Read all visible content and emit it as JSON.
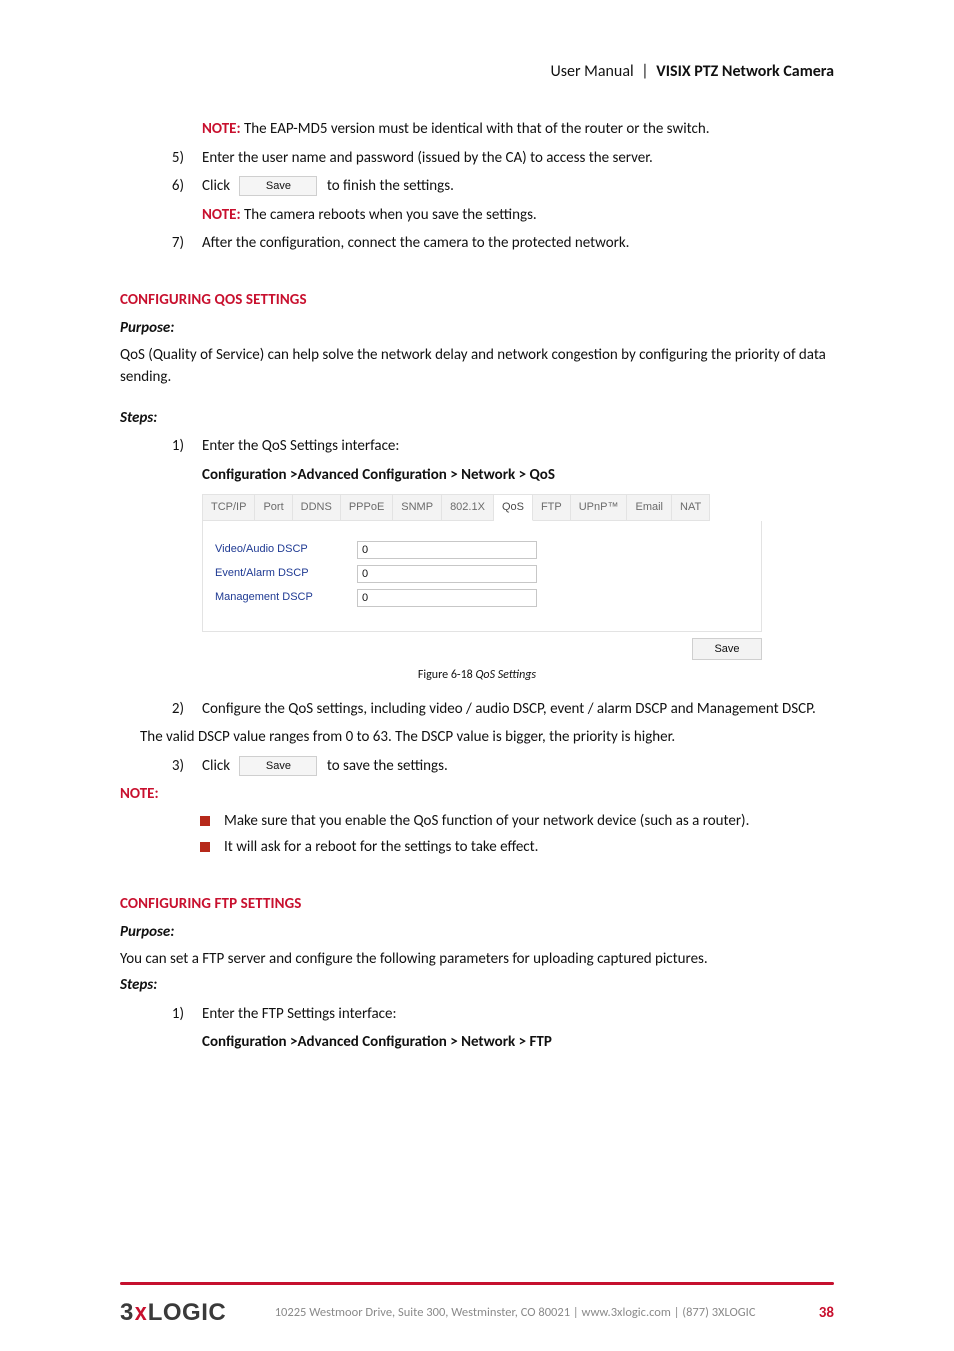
{
  "header": {
    "manual_label": "User Manual",
    "pipe": "|",
    "product": "VISIX PTZ Network Camera"
  },
  "section_a_continued": {
    "note4": {
      "label": "NOTE:",
      "text": "The EAP-MD5 version must be identical with that of the router or the switch."
    },
    "step5": {
      "num": "5)",
      "text": "Enter the user name and password (issued by the CA) to access the server."
    },
    "step6": {
      "num": "6)",
      "pre": "Click",
      "btn": "Save",
      "post": "to finish the settings."
    },
    "note6": {
      "label": "NOTE:",
      "text": "The camera reboots when you save the settings."
    },
    "step7": {
      "num": "7)",
      "text": "After the configuration, connect the camera to the protected network."
    }
  },
  "qos": {
    "heading": "CONFIGURING QOS SETTINGS",
    "purpose_label": "Purpose:",
    "purpose_text": "QoS (Quality of Service) can help solve the network delay and network congestion by configuring the priority of data sending.",
    "steps_label": "Steps:",
    "step1": {
      "num": "1)",
      "text": "Enter the QoS Settings interface:"
    },
    "path": "Configuration >Advanced Configuration > Network > QoS",
    "fig": {
      "tabs": [
        "TCP/IP",
        "Port",
        "DDNS",
        "PPPoE",
        "SNMP",
        "802.1X",
        "QoS",
        "FTP",
        "UPnP™",
        "Email",
        "NAT"
      ],
      "rows": [
        {
          "label": "Video/Audio DSCP",
          "value": "0"
        },
        {
          "label": "Event/Alarm DSCP",
          "value": "0"
        },
        {
          "label": "Management DSCP",
          "value": "0"
        }
      ],
      "save": "Save"
    },
    "caption": {
      "lead": "Figure 6-18 ",
      "title": "QoS Settings"
    },
    "step2": {
      "num": "2)",
      "text": "Configure the QoS settings, including video / audio DSCP, event / alarm DSCP and Management DSCP."
    },
    "valid_text": "The valid DSCP value ranges from 0 to 63. The DSCP value is bigger, the priority is higher.",
    "step3": {
      "num": "3)",
      "pre": "Click",
      "btn": "Save",
      "post": "to save the settings."
    },
    "note_label": "NOTE:",
    "bullets": [
      "Make sure that you enable the QoS function of your network device (such as a router).",
      "It will ask for a reboot for the settings to take effect."
    ]
  },
  "ftp": {
    "heading": "CONFIGURING FTP SETTINGS",
    "purpose_label": "Purpose:",
    "purpose_text": "You can set a FTP server and configure the following parameters for uploading captured pictures.",
    "steps_label": "Steps:",
    "step1": {
      "num": "1)",
      "text": "Enter the FTP Settings interface:"
    },
    "path": "Configuration >Advanced Configuration > Network > FTP"
  },
  "footer": {
    "logo_a": "3",
    "logo_x": "x",
    "logo_b": "LOGIC",
    "address": "10225 Westmoor Drive, Suite 300, Westminster, CO 80021 | www.3xlogic.com | (877) 3XLOGIC",
    "page": "38"
  }
}
